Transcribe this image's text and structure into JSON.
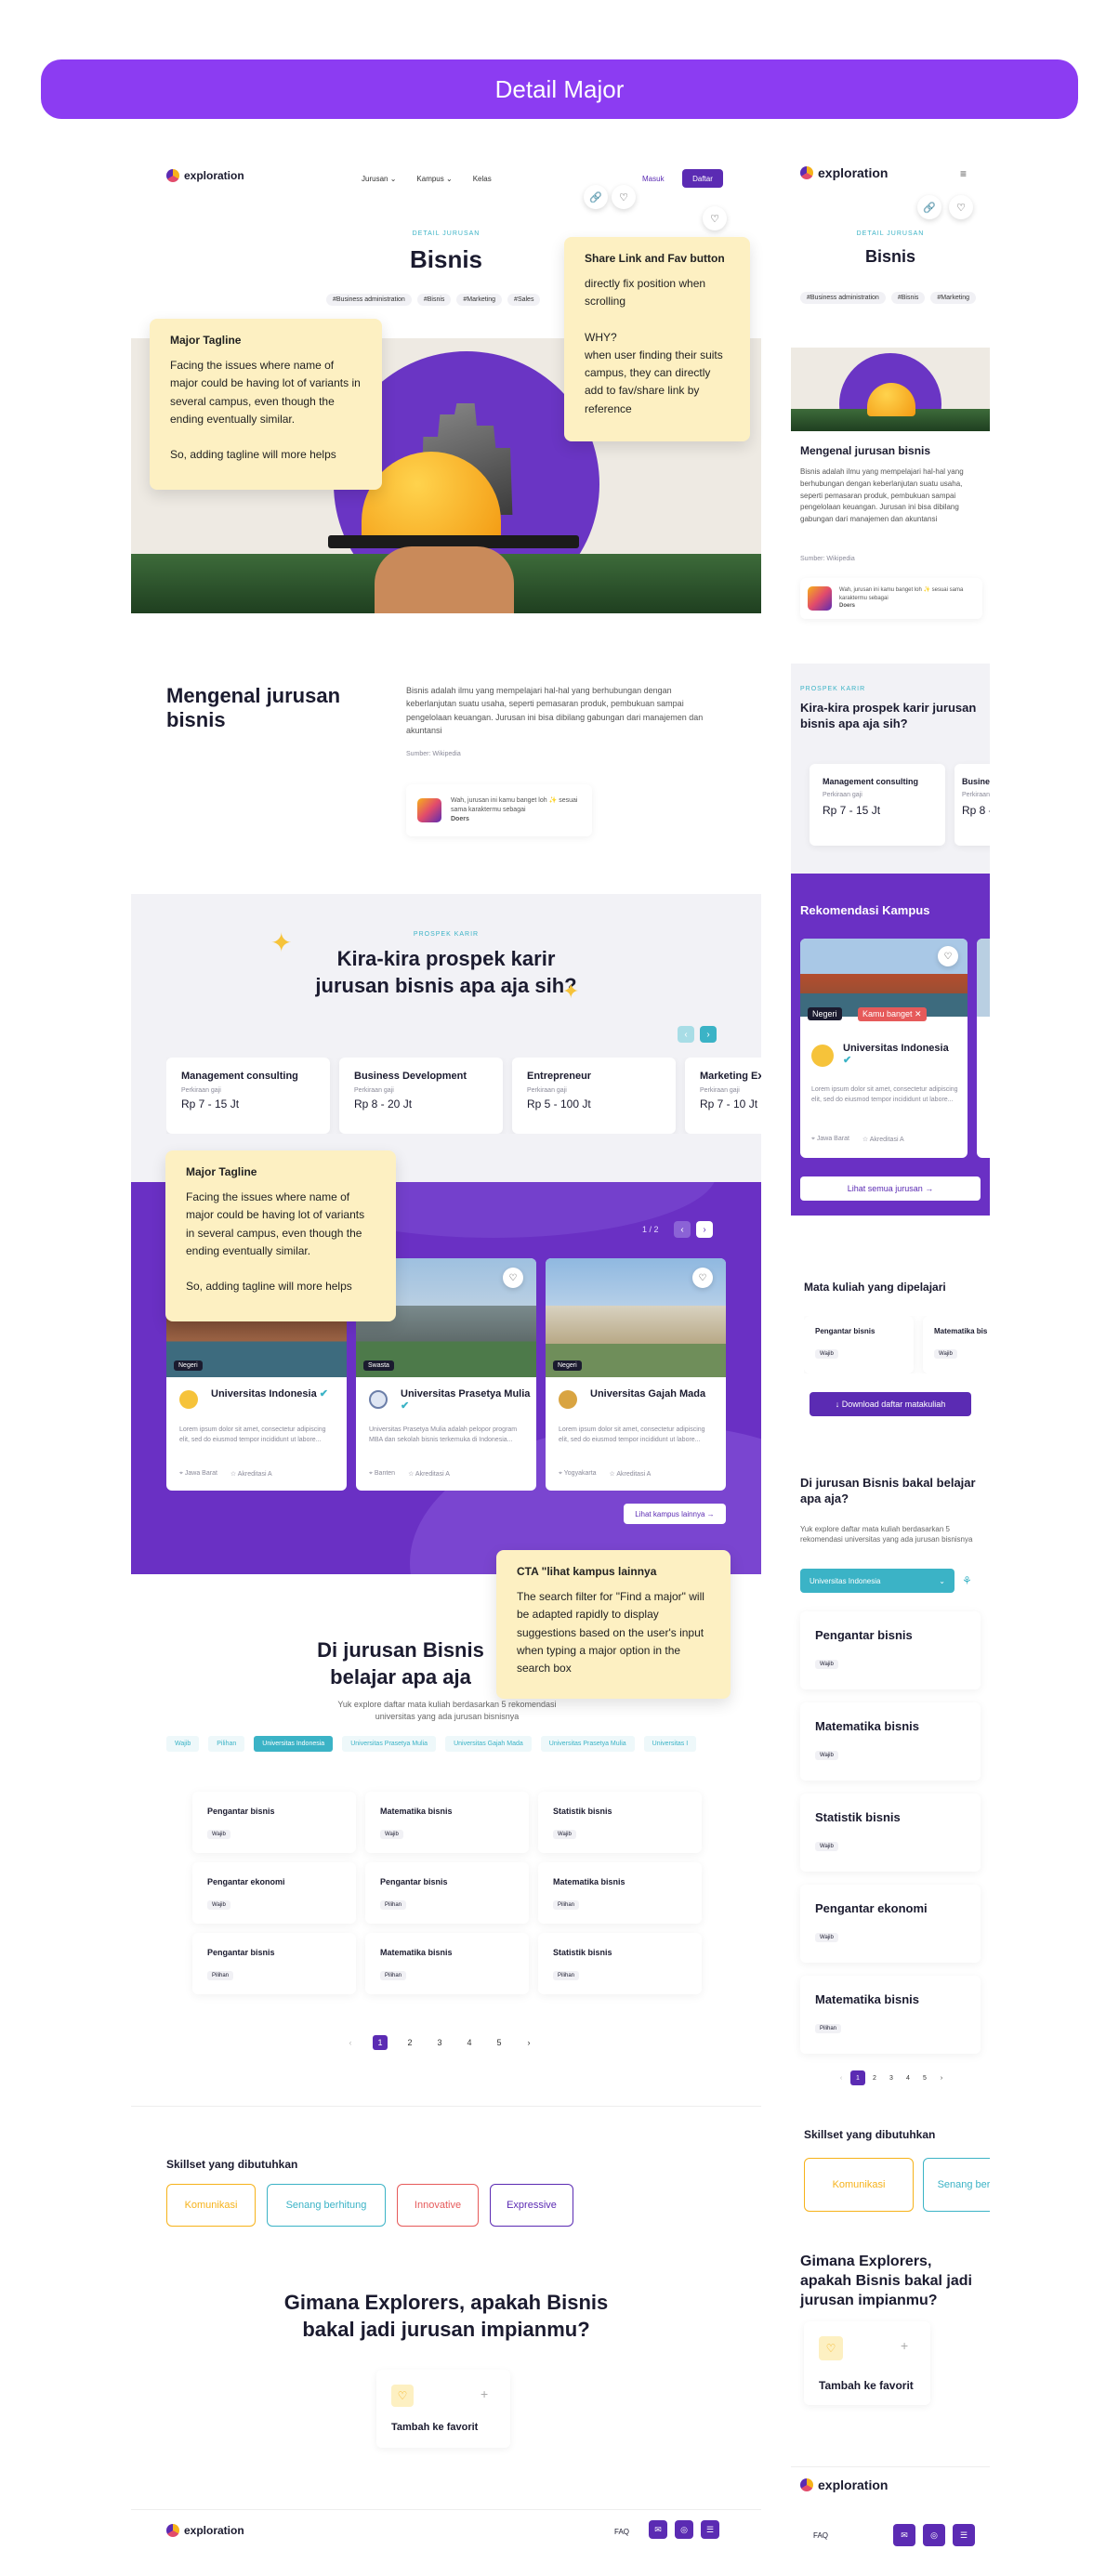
{
  "page_title": "Detail Major",
  "brand": "exploration",
  "nav": {
    "items": [
      "Jurusan",
      "Kampus",
      "Kelas"
    ],
    "login": "Masuk",
    "register": "Daftar"
  },
  "header": {
    "kicker": "DETAIL JURUSAN",
    "major": "Bisnis",
    "tags": [
      "#Business administration",
      "#Bisnis",
      "#Marketing",
      "#Sales"
    ]
  },
  "notes": {
    "tagline1": {
      "title": "Major Tagline",
      "body": "Facing the issues where name of major could be having lot of variants in several campus, even though the ending eventually similar.",
      "body2": "So, adding tagline will more helps"
    },
    "share": {
      "title": "Share Link and Fav button",
      "body": "directly  fix position when scrolling",
      "why": "WHY?",
      "body2": "when user finding their suits campus, they can directly add to fav/share link by reference"
    },
    "tagline2": {
      "title": "Major Tagline",
      "body": "Facing the issues where name of major could be having lot of variants in several campus, even though the ending eventually similar.",
      "body2": "So, adding tagline will more helps"
    },
    "cta": {
      "title": "CTA \"lihat kampus lainnya",
      "body": "The search filter for \"Find a major\" will be adapted rapidly to display suggestions based on the user's input when typing a major option in the search box"
    }
  },
  "about": {
    "title": "Mengenal jurusan bisnis",
    "text": "Bisnis adalah ilmu yang mempelajari hal-hal yang berhubungan dengan keberlanjutan suatu usaha, seperti pemasaran produk, pembukuan sampai pengelolaan keuangan. Jurusan ini bisa dibilang gabungan dari manajemen dan akuntansi",
    "source": "Sumber: Wikipedia",
    "match_text": "Wah, jurusan ini kamu banget loh ✨ sesuai sama karaktermu sebagai",
    "match_type": "Doers"
  },
  "career": {
    "kicker": "PROSPEK KARIR",
    "title": "Kira-kira prospek karir jurusan bisnis apa aja sih?",
    "salary_label": "Perkiraan gaji",
    "cards": [
      {
        "name": "Management consulting",
        "salary": "Rp 7 - 15 Jt"
      },
      {
        "name": "Business Development",
        "salary": "Rp 8 - 20 Jt"
      },
      {
        "name": "Entrepreneur",
        "salary": "Rp 5 - 100 Jt"
      },
      {
        "name": "Marketing Ex",
        "salary": "Rp 7 - 10 Jt"
      }
    ]
  },
  "campus": {
    "title": "Rekomendasi Kampus",
    "pager": "1 / 2",
    "cards": [
      {
        "type": "Negeri",
        "name": "Universitas Indonesia",
        "desc": "Lorem ipsum dolor sit amet, consectetur adipiscing elit, sed do eiusmod tempor incididunt ut labore...",
        "location": "Jawa Barat",
        "accr": "Akreditasi A"
      },
      {
        "type": "Swasta",
        "name": "Universitas Prasetya Mulia",
        "desc": "Universitas Prasetya Mulia adalah pelopor program MBA dan sekolah bisnis terkemuka di Indonesia...",
        "location": "Banten",
        "accr": "Akreditasi A"
      },
      {
        "type": "Negeri",
        "name": "Universitas Gajah Mada",
        "desc": "Lorem ipsum dolor sit amet, consectetur adipiscing elit, sed do eiusmod tempor incididunt ut labore...",
        "location": "Yogyakarta",
        "accr": "Akreditasi A"
      }
    ],
    "more": "Lihat kampus lainnya",
    "mobile_more": "Lihat semua jurusan",
    "mobile_badge": "Kamu banget"
  },
  "courses": {
    "title": "Di jurusan Bisnis bakal belajar apa aja?",
    "desk_title_1": "Di jurusan Bisnis",
    "desk_title_2": "belajar apa aja",
    "subtitle": "Yuk explore daftar mata kuliah berdasarkan 5 rekomendasi universitas yang ada jurusan bisnisnya",
    "filters": [
      "Wajib",
      "Pilihan",
      "Universitas Indonesia",
      "Universitas Prasetya Mulia",
      "Universitas Gajah Mada",
      "Universitas Prasetya Mulia",
      "Universitas I"
    ],
    "items": [
      {
        "name": "Pengantar bisnis",
        "type": "Wajib"
      },
      {
        "name": "Matematika bisnis",
        "type": "Wajib"
      },
      {
        "name": "Statistik bisnis",
        "type": "Wajib"
      },
      {
        "name": "Pengantar ekonomi",
        "type": "Wajib"
      },
      {
        "name": "Pengantar bisnis",
        "type": "Pilihan"
      },
      {
        "name": "Matematika bisnis",
        "type": "Pilihan"
      },
      {
        "name": "Pengantar bisnis",
        "type": "Pilihan"
      },
      {
        "name": "Matematika bisnis",
        "type": "Pilihan"
      },
      {
        "name": "Statistik bisnis",
        "type": "Pilihan"
      }
    ],
    "pages": [
      "1",
      "2",
      "3",
      "4",
      "5"
    ],
    "mobile_selected": "Universitas Indonesia",
    "mobile_items": [
      {
        "name": "Pengantar bisnis",
        "type": "Wajib"
      },
      {
        "name": "Matematika bisnis",
        "type": "Wajib"
      },
      {
        "name": "Statistik bisnis",
        "type": "Wajib"
      },
      {
        "name": "Pengantar ekonomi",
        "type": "Wajib"
      },
      {
        "name": "Matematika bisnis",
        "type": "Pilihan"
      }
    ]
  },
  "mobile_mk": {
    "title": "Mata kuliah yang dipelajari",
    "items": [
      {
        "name": "Pengantar bisnis",
        "type": "Wajib"
      },
      {
        "name": "Matematika bis",
        "type": "Wajib"
      }
    ],
    "download": "Download daftar matakuliah"
  },
  "skills": {
    "title": "Skillset yang dibutuhkan",
    "items": [
      {
        "label": "Komunikasi",
        "color": "#f6b21a"
      },
      {
        "label": "Senang berhitung",
        "color": "#3bb3c6"
      },
      {
        "label": "Innovative",
        "color": "#e65a5a"
      },
      {
        "label": "Expressive",
        "color": "#5b2bb3"
      }
    ]
  },
  "dream": {
    "title": "Gimana Explorers, apakah Bisnis bakal jadi jurusan impianmu?",
    "fav": "Tambah ke favorit"
  },
  "footer": {
    "faq": "FAQ"
  }
}
